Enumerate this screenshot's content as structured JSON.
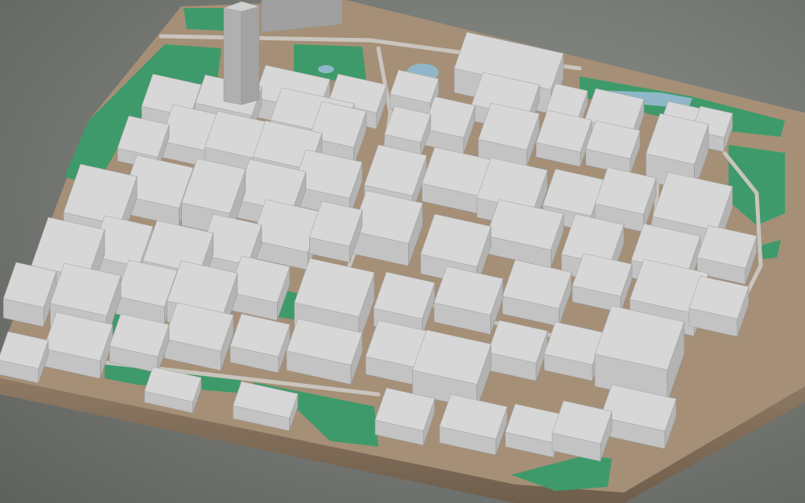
{
  "scene": {
    "type": "3d-city-block-model",
    "colors": {
      "background_light": "#8e918c",
      "background_dark": "#5e615d",
      "base_top": "#a58f77",
      "base_side": "#8a7560",
      "green": "#3e9a6a",
      "water": "#8fb7c9",
      "building_top": "#d7d7d7",
      "building_left": "#c3c3c3",
      "building_right": "#b3b3b3",
      "road": "#c9c4bd"
    }
  }
}
